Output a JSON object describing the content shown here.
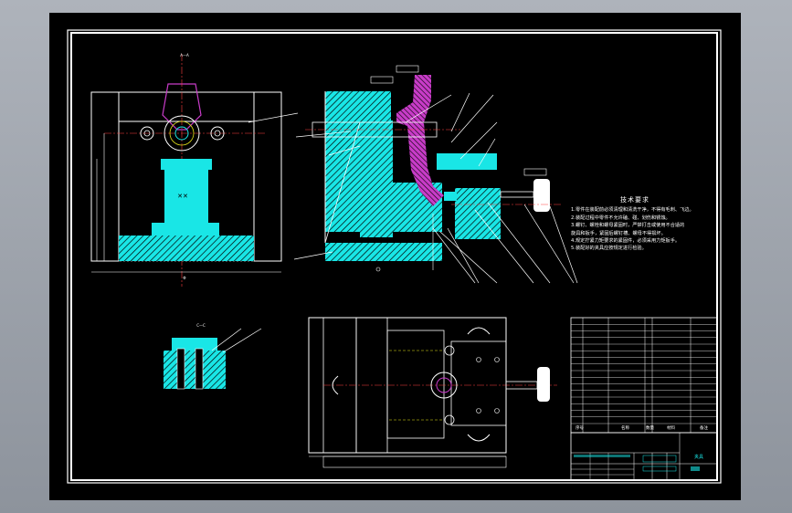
{
  "notes": {
    "title": "技术要求",
    "lines": [
      "1.零件在装配前必须清理和清洗干净，不得有毛刺、飞边。",
      "2.装配过程中零件不允许磕、碰、划伤和锈蚀。",
      "3.螺钉、螺栓和螺母紧固时，严禁打击或使用不合适的",
      "  旋具和扳手，紧固后螺钉槽、螺母不得损坏。",
      "4.规定拧紧力矩要求的紧固件，必须采用力矩扳手。",
      "5.装配好的夹具应按规定进行检验。"
    ]
  },
  "views": {
    "section_label": "A—A",
    "detail_label": "C—C",
    "datum_label": "Φ"
  },
  "bom": {
    "headers": [
      "序号",
      "名称",
      "数量",
      "材料",
      "备注"
    ],
    "rows": 16
  },
  "title_block": {
    "cells": [
      "夹具",
      "",
      "",
      "",
      ""
    ]
  },
  "colors": {
    "frame": "#ffffff",
    "part_cyan": "#19e6e6",
    "part_magenta": "#c83cc8",
    "centerline": "#ff4040",
    "leader": "#ffffff",
    "hidden": "#e6e619"
  }
}
